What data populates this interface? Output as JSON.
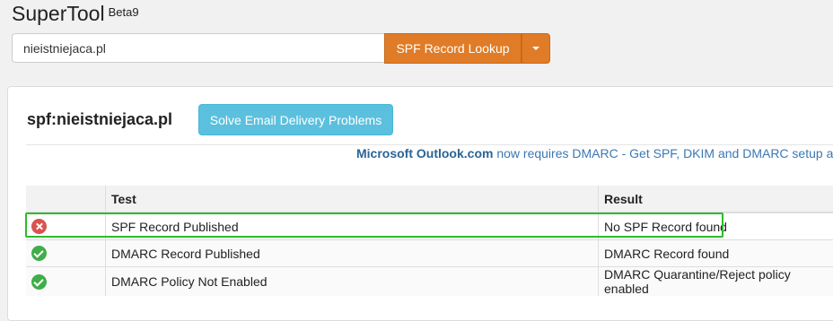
{
  "header": {
    "app_name": "SuperTool",
    "version_badge": "Beta9"
  },
  "search": {
    "value": "nieistniejaca.pl",
    "lookup_label": "SPF Record Lookup"
  },
  "panel": {
    "domain_title": "spf:nieistniejaca.pl",
    "solve_label": "Solve Email Delivery Problems",
    "notice_link": "Microsoft Outlook.com",
    "notice_text": " now requires DMARC - Get SPF, DKIM and DMARC setup a"
  },
  "table": {
    "headers": {
      "icon": "",
      "test": "Test",
      "result": "Result"
    },
    "rows": [
      {
        "status": "fail",
        "status_icon": "x-circle-icon",
        "test": "SPF Record Published",
        "result": "No SPF Record found"
      },
      {
        "status": "pass",
        "status_icon": "check-circle-icon",
        "test": "DMARC Record Published",
        "result": "DMARC Record found"
      },
      {
        "status": "pass",
        "status_icon": "check-circle-icon",
        "test": "DMARC Policy Not Enabled",
        "result": "DMARC Quarantine/Reject policy enabled"
      }
    ]
  },
  "colors": {
    "lookup_button": "#e07c27",
    "solve_button": "#5bc0de",
    "fail": "#d9534f",
    "pass": "#3fae49",
    "highlight": "#2dbb2d"
  }
}
